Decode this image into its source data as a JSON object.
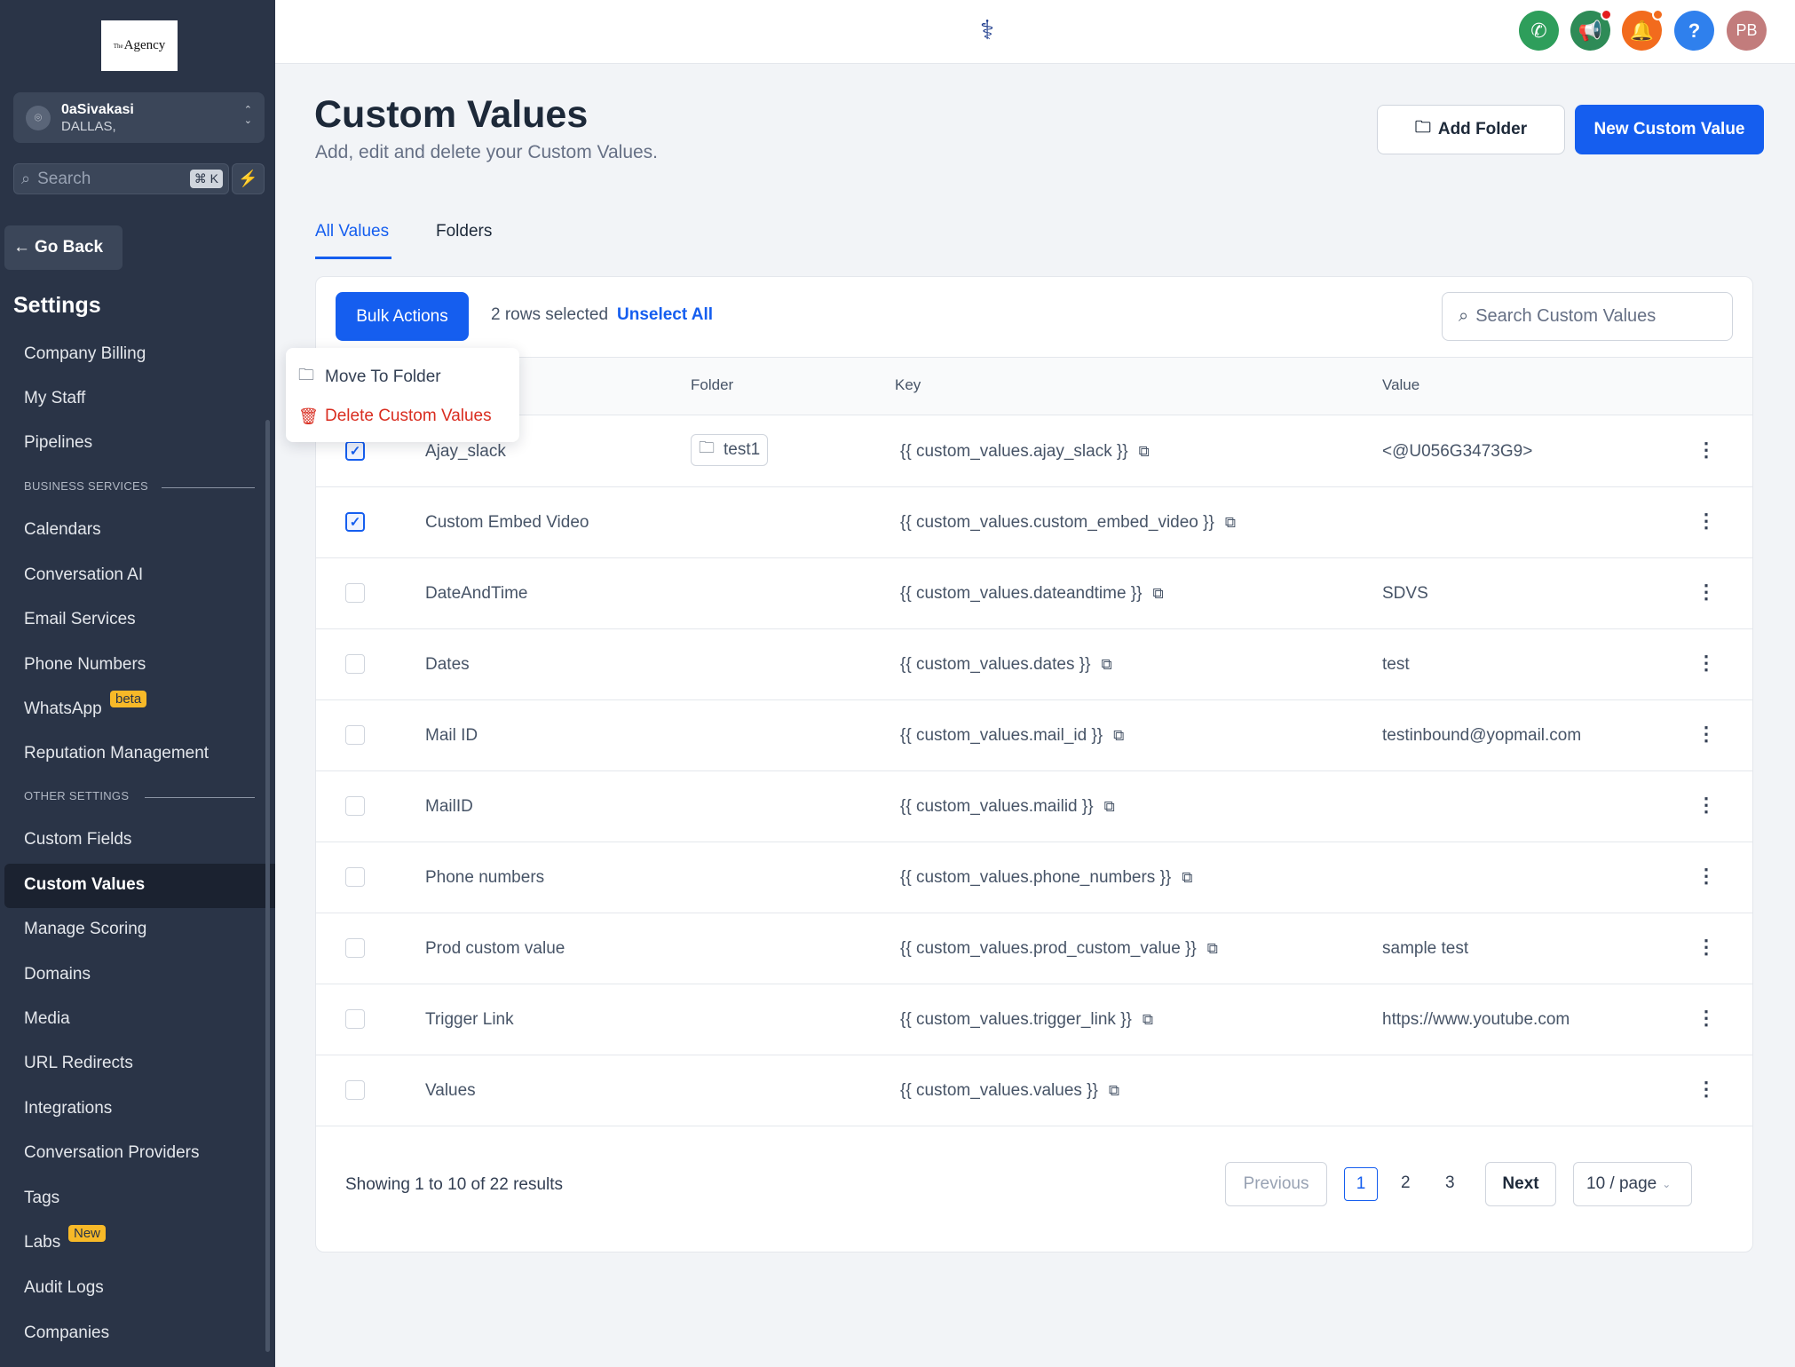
{
  "sidebar": {
    "logo_text": "Agency",
    "logo_sup": "The",
    "account": {
      "name": "0aSivakasi",
      "location": "DALLAS,"
    },
    "search": {
      "placeholder": "Search",
      "shortcut": "⌘ K"
    },
    "go_back": "Go Back",
    "settings_title": "Settings",
    "items_top": [
      "Company Billing",
      "My Staff",
      "Pipelines"
    ],
    "section_business": "BUSINESS SERVICES",
    "items_business": [
      "Calendars",
      "Conversation AI",
      "Email Services",
      "Phone Numbers",
      "WhatsApp",
      "Reputation Management"
    ],
    "whatsapp_badge": "beta",
    "section_other": "OTHER SETTINGS",
    "items_other": [
      "Custom Fields",
      "Custom Values",
      "Manage Scoring",
      "Domains",
      "Media",
      "URL Redirects",
      "Integrations",
      "Conversation Providers",
      "Tags",
      "Labs",
      "Audit Logs",
      "Companies"
    ],
    "labs_badge": "New",
    "active_item": "Custom Values"
  },
  "header": {
    "avatar_initials": "PB",
    "colors": {
      "phone": "#2e9e5b",
      "megaphone": "#2e8b57",
      "bell": "#f26b1d",
      "help": "#2f80ed",
      "avatar": "#c27c7c"
    }
  },
  "page": {
    "title": "Custom Values",
    "subtitle": "Add, edit and delete your Custom Values.",
    "add_folder": "Add Folder",
    "new_value": "New Custom Value",
    "tabs": [
      "All Values",
      "Folders"
    ]
  },
  "toolbar": {
    "bulk_actions": "Bulk Actions",
    "selection_text": "2 rows selected",
    "unselect_all": "Unselect All",
    "search_placeholder": "Search Custom Values"
  },
  "bulk_menu": {
    "move": "Move To Folder",
    "delete": "Delete Custom Values"
  },
  "table": {
    "columns": {
      "folder": "Folder",
      "key": "Key",
      "value": "Value"
    },
    "rows": [
      {
        "name": "Ajay_slack",
        "folder": "test1",
        "key": "{{ custom_values.ajay_slack }}",
        "value": "<@U056G3473G9>",
        "checked": true
      },
      {
        "name": "Custom Embed Video",
        "folder": "",
        "key": "{{ custom_values.custom_embed_video }}",
        "value": "",
        "checked": true
      },
      {
        "name": "DateAndTime",
        "folder": "",
        "key": "{{ custom_values.dateandtime }}",
        "value": "SDVS",
        "checked": false
      },
      {
        "name": "Dates",
        "folder": "",
        "key": "{{ custom_values.dates }}",
        "value": "test",
        "checked": false
      },
      {
        "name": "Mail ID",
        "folder": "",
        "key": "{{ custom_values.mail_id }}",
        "value": "testinbound@yopmail.com",
        "checked": false
      },
      {
        "name": "MailID",
        "folder": "",
        "key": "{{ custom_values.mailid }}",
        "value": "",
        "checked": false
      },
      {
        "name": "Phone numbers",
        "folder": "",
        "key": "{{ custom_values.phone_numbers }}",
        "value": "",
        "checked": false
      },
      {
        "name": "Prod custom value",
        "folder": "",
        "key": "{{ custom_values.prod_custom_value }}",
        "value": "sample test",
        "checked": false
      },
      {
        "name": "Trigger Link",
        "folder": "",
        "key": "{{ custom_values.trigger_link }}",
        "value": "https://www.youtube.com",
        "checked": false
      },
      {
        "name": "Values",
        "folder": "",
        "key": "{{ custom_values.values }}",
        "value": "",
        "checked": false
      }
    ]
  },
  "pagination": {
    "summary": "Showing 1 to 10 of 22 results",
    "previous": "Previous",
    "pages": [
      "1",
      "2",
      "3"
    ],
    "next": "Next",
    "page_size": "10 / page"
  }
}
